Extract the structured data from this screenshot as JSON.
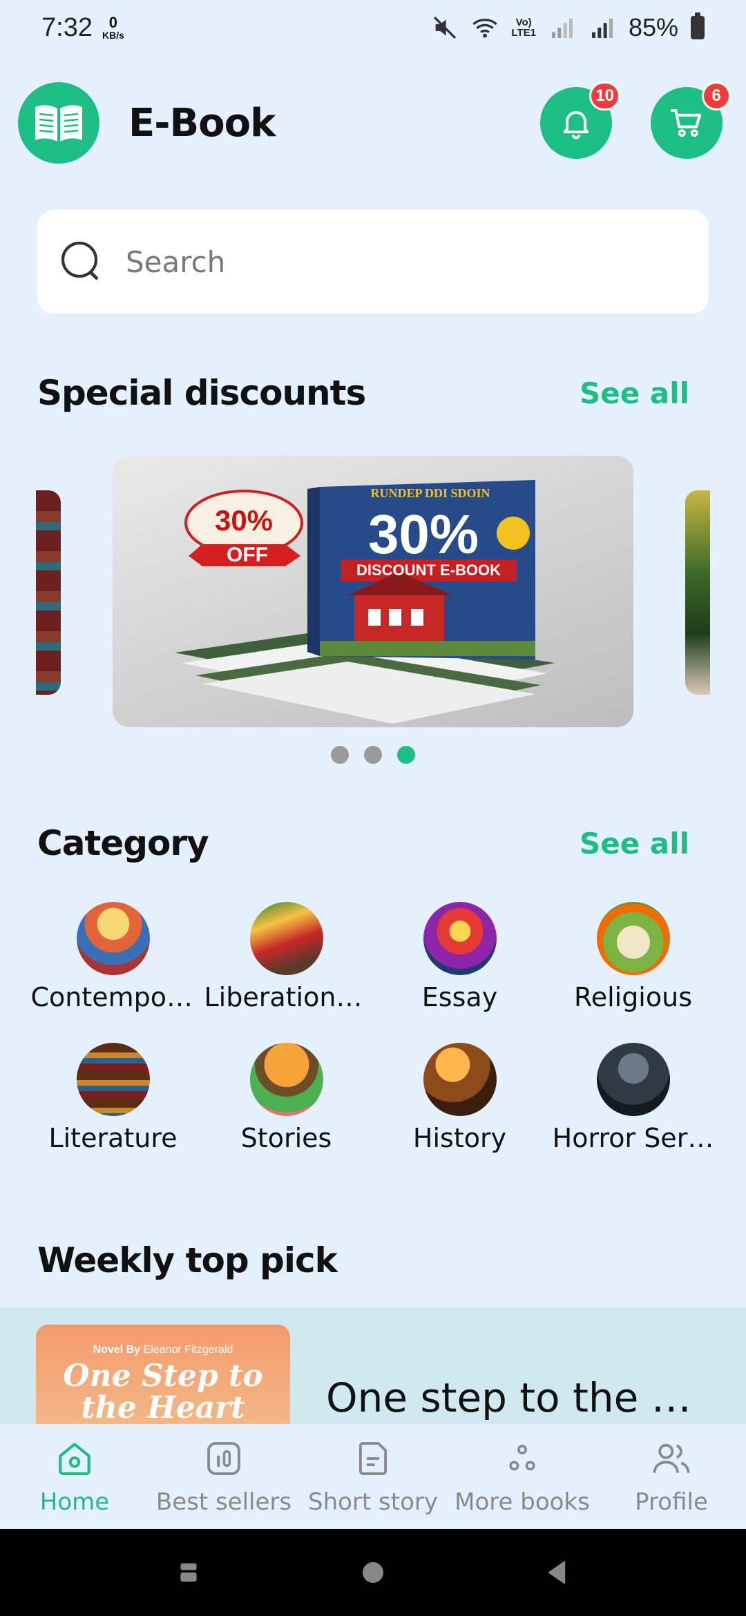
{
  "status_bar": {
    "time": "7:32",
    "net_speed_value": "0",
    "net_speed_unit": "KB/s",
    "volte_top": "Vo)",
    "volte_bottom": "LTE1",
    "battery": "85%"
  },
  "header": {
    "app_title": "E-Book",
    "notification_count": "10",
    "cart_count": "6"
  },
  "search": {
    "placeholder": "Search"
  },
  "special_discounts": {
    "title": "Special discounts",
    "see_all": "See all",
    "banner": {
      "sticker_percent": "30%",
      "sticker_off": "OFF",
      "book_header": "RUNDEP DDI SDOIN",
      "book_percent": "30%",
      "book_ribbon": "DISCOUNT E-BOOK"
    },
    "dots_total": 3,
    "dots_active_index": 2
  },
  "category": {
    "title": "Category",
    "see_all": "See all",
    "items": [
      {
        "label": "Contempor…",
        "icon": "contemporary-stories-thumb"
      },
      {
        "label": "Liberation …",
        "icon": "liberation-thumb"
      },
      {
        "label": "Essay",
        "icon": "essay-thumb"
      },
      {
        "label": "Religious",
        "icon": "religious-thumb"
      },
      {
        "label": "Literature",
        "icon": "literature-thumb"
      },
      {
        "label": "Stories",
        "icon": "stories-thumb"
      },
      {
        "label": "History",
        "icon": "history-thumb"
      },
      {
        "label": "Horror Ser…",
        "icon": "horror-thumb"
      }
    ]
  },
  "weekly_top_pick": {
    "title": "Weekly top pick",
    "cover_by_prefix": "Novel By",
    "cover_author": "Eleanor Fitzgerald",
    "cover_title": "One Step to the Heart",
    "book_title": "One step to the he…"
  },
  "bottom_nav": [
    {
      "label": "Home",
      "icon": "home-icon",
      "active": true
    },
    {
      "label": "Best sellers",
      "icon": "chart-icon",
      "active": false
    },
    {
      "label": "Short story",
      "icon": "document-icon",
      "active": false
    },
    {
      "label": "More books",
      "icon": "dots-icon",
      "active": false
    },
    {
      "label": "Profile",
      "icon": "users-icon",
      "active": false
    }
  ],
  "colors": {
    "accent": "#1dbe86",
    "background": "#e4f0fb",
    "badge": "#ee3b3b"
  }
}
